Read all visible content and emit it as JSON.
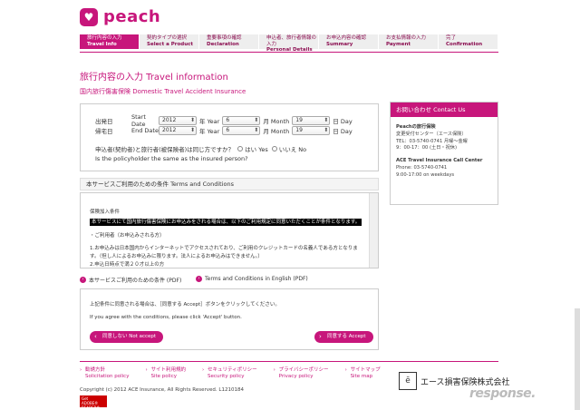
{
  "brand": {
    "logo_text": "peach",
    "brand_color": "#c7167b"
  },
  "steps": [
    {
      "jp": "旅行内容の入力",
      "en": "Travel Info",
      "active": true
    },
    {
      "jp": "契約タイプの選択",
      "en": "Select a Product",
      "active": false
    },
    {
      "jp": "重要事項の確認",
      "en": "Declaration",
      "active": false
    },
    {
      "jp": "申込者、旅行者情報の入力",
      "en": "Personal Details",
      "active": false
    },
    {
      "jp": "お申込内容の確認",
      "en": "Summary",
      "active": false
    },
    {
      "jp": "お支払情報の入力",
      "en": "Payment",
      "active": false
    },
    {
      "jp": "完了",
      "en": "Confirmation",
      "active": false
    }
  ],
  "page_title": "旅行内容の入力 Travel information",
  "subtitle": "国内旅行傷害保険 Domestic Travel Accident Insurance",
  "form": {
    "start": {
      "jp": "出発日",
      "en": "Start Date",
      "year": "2012",
      "month": "6",
      "day": "19"
    },
    "end": {
      "jp": "帰宅日",
      "en": "End Date",
      "year": "2012",
      "month": "6",
      "day": "19"
    },
    "year_label": "年 Year",
    "month_label": "月 Month",
    "day_label": "日 Day",
    "question_jp": "申込者(契約者)と旅行者(被保険者)は同じ方ですか？",
    "question_en": "Is the policyholder the same as the insured person?",
    "yes_label": "はい Yes",
    "no_label": "いいえ No"
  },
  "sidebar": {
    "title": "お問い合わせ Contact Us",
    "peach_name": "Peachの旅行保険",
    "peach_center": "変更受付センター（エース保険）",
    "peach_tel": "TEL：03-5740-0741 月曜〜金曜",
    "peach_hours": "9：00-17：00 (土日・祝休)",
    "ace_name": "ACE Travel Insurance Call Center",
    "ace_phone": "Phone: 03-5740-0741",
    "ace_hours": "9:00-17:00 on weekdays"
  },
  "terms": {
    "heading": "本サービスご利用のための条件 Terms and Conditions",
    "line1": "保険加入条件",
    "black_line": "本サービスにて国内旅行傷害保険にお申込みをされる場合は、以下のご利用規定に同意いただくことが条件となります。",
    "line3": "・ご利用者（お申込みされる方）",
    "line4": "1.お申込みは日本国内からインターネットでアクセスされており、ご利用のクレジットカードの名義人である方となりま",
    "line5": "す。（但し人によるお申込みに限ります。法人によるお申込みはできません。）",
    "line6": "2.申込日時点で満２０才以上の方"
  },
  "pdf_links": {
    "jp": "本サービスご利用のための条件 (PDF)",
    "en": "Terms and Conditions in English (PDF)"
  },
  "consent": {
    "line1": "上記条件に同意される場合は、［同意する Accept］ボタンをクリックしてください。",
    "line2": "If you agree with the conditions, please click 'Accept' button.",
    "not_accept": "同意しない Not accept",
    "accept": "同意する Accept"
  },
  "footer": {
    "links": [
      {
        "jp": "勧誘方針",
        "en": "Solicitation policy"
      },
      {
        "jp": "サイト利用規約",
        "en": "Site policy"
      },
      {
        "jp": "セキュリティポリシー",
        "en": "Security policy"
      },
      {
        "jp": "プライバシーポリシー",
        "en": "Privacy policy"
      },
      {
        "jp": "サイトマップ",
        "en": "Site map"
      }
    ],
    "copyright": "Copyright (c) 2012 ACE Insurance, All Rights Reserved. L1210184",
    "adobe": "Get ADOBE® READER®",
    "ace_logo": "エース損害保険株式会社",
    "watermark": "response."
  }
}
